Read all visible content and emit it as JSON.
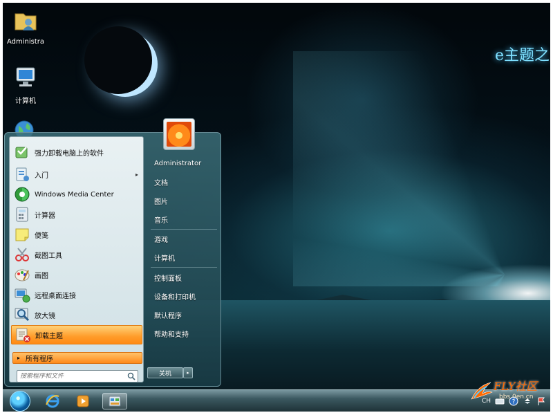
{
  "desktop": {
    "logo_text": "e主题之",
    "icons": [
      {
        "label": "Administra",
        "icon": "user-folder-icon"
      },
      {
        "label": "计算机",
        "icon": "computer-icon"
      },
      {
        "label": "",
        "icon": "network-globe-icon"
      }
    ]
  },
  "start_menu": {
    "programs": [
      {
        "label": "强力卸载电脑上的软件",
        "icon": "uninstaller-icon",
        "has_submenu": false,
        "highlighted": false
      },
      {
        "label": "入门",
        "icon": "getting-started-icon",
        "has_submenu": true,
        "highlighted": false
      },
      {
        "label": "Windows Media Center",
        "icon": "media-center-icon",
        "has_submenu": false,
        "highlighted": false
      },
      {
        "label": "计算器",
        "icon": "calculator-icon",
        "has_submenu": false,
        "highlighted": false
      },
      {
        "label": "便笺",
        "icon": "sticky-notes-icon",
        "has_submenu": false,
        "highlighted": false
      },
      {
        "label": "截图工具",
        "icon": "snipping-tool-icon",
        "has_submenu": false,
        "highlighted": false
      },
      {
        "label": "画图",
        "icon": "paint-icon",
        "has_submenu": false,
        "highlighted": false
      },
      {
        "label": "远程桌面连接",
        "icon": "remote-desktop-icon",
        "has_submenu": false,
        "highlighted": false
      },
      {
        "label": "放大镜",
        "icon": "magnifier-icon",
        "has_submenu": false,
        "highlighted": false
      },
      {
        "label": "卸载主题",
        "icon": "uninstall-theme-icon",
        "has_submenu": false,
        "highlighted": true
      }
    ],
    "all_programs": "所有程序",
    "search_placeholder": "搜索程序和文件",
    "right_items": [
      {
        "label": "Administrator"
      },
      {
        "label": "文档"
      },
      {
        "label": "图片"
      },
      {
        "label": "音乐"
      },
      {
        "label": "游戏"
      },
      {
        "label": "计算机"
      },
      {
        "label": "控制面板"
      },
      {
        "label": "设备和打印机"
      },
      {
        "label": "默认程序"
      },
      {
        "label": "帮助和支持"
      }
    ],
    "shutdown_label": "关机",
    "shutdown_arrow": "▸",
    "arrow_glyph": "▸"
  },
  "taskbar": {
    "pinned": [
      {
        "name": "internet-explorer-icon"
      },
      {
        "name": "media-player-icon"
      },
      {
        "name": "control-panel-icon",
        "active": true
      }
    ],
    "tray": {
      "language": "CH",
      "time": ""
    }
  },
  "watermark": {
    "brand": "FLY社区",
    "url": "bbs.0en.cn"
  },
  "colors": {
    "highlight_orange": "#ff9c2a",
    "menu_teal": "#2f5f69",
    "logo_cyan": "#7ee0ff"
  }
}
